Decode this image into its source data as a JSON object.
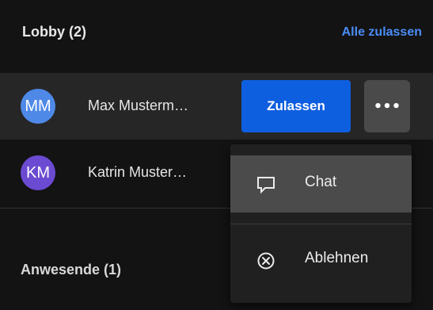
{
  "lobby": {
    "title": "Lobby (2)",
    "admit_all_label": "Alle zulassen"
  },
  "participants": [
    {
      "initials": "MM",
      "name": "Max Musterm…",
      "avatar_color": "#4f89e8",
      "admit_label": "Zulassen",
      "more_label": "•••"
    },
    {
      "initials": "KM",
      "name": "Katrin Muster…",
      "avatar_color": "#6b4bd1"
    }
  ],
  "attendees": {
    "title": "Anwesende (1)"
  },
  "context_menu": {
    "items": [
      {
        "label": "Chat",
        "icon": "chat-icon",
        "highlighted": true
      },
      {
        "label": "Ablehnen",
        "icon": "reject-circle-x-icon",
        "highlighted": false
      }
    ]
  },
  "colors": {
    "background": "#131313",
    "row_highlight": "#262626",
    "accent_link": "#4a8df7",
    "primary_button": "#0e5ee0",
    "menu_background": "#202020",
    "menu_item_hover": "#4b4b4b"
  }
}
